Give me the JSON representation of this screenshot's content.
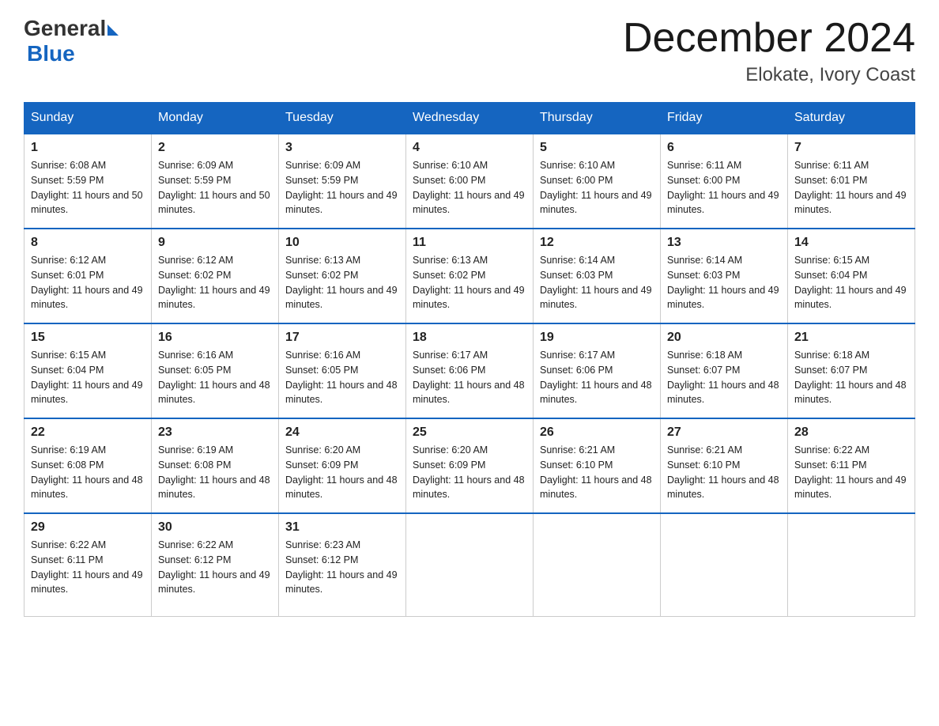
{
  "header": {
    "logo_general": "General",
    "logo_blue": "Blue",
    "month_title": "December 2024",
    "location": "Elokate, Ivory Coast"
  },
  "weekdays": [
    "Sunday",
    "Monday",
    "Tuesday",
    "Wednesday",
    "Thursday",
    "Friday",
    "Saturday"
  ],
  "weeks": [
    [
      {
        "day": "1",
        "sunrise": "6:08 AM",
        "sunset": "5:59 PM",
        "daylight": "11 hours and 50 minutes."
      },
      {
        "day": "2",
        "sunrise": "6:09 AM",
        "sunset": "5:59 PM",
        "daylight": "11 hours and 50 minutes."
      },
      {
        "day": "3",
        "sunrise": "6:09 AM",
        "sunset": "5:59 PM",
        "daylight": "11 hours and 49 minutes."
      },
      {
        "day": "4",
        "sunrise": "6:10 AM",
        "sunset": "6:00 PM",
        "daylight": "11 hours and 49 minutes."
      },
      {
        "day": "5",
        "sunrise": "6:10 AM",
        "sunset": "6:00 PM",
        "daylight": "11 hours and 49 minutes."
      },
      {
        "day": "6",
        "sunrise": "6:11 AM",
        "sunset": "6:00 PM",
        "daylight": "11 hours and 49 minutes."
      },
      {
        "day": "7",
        "sunrise": "6:11 AM",
        "sunset": "6:01 PM",
        "daylight": "11 hours and 49 minutes."
      }
    ],
    [
      {
        "day": "8",
        "sunrise": "6:12 AM",
        "sunset": "6:01 PM",
        "daylight": "11 hours and 49 minutes."
      },
      {
        "day": "9",
        "sunrise": "6:12 AM",
        "sunset": "6:02 PM",
        "daylight": "11 hours and 49 minutes."
      },
      {
        "day": "10",
        "sunrise": "6:13 AM",
        "sunset": "6:02 PM",
        "daylight": "11 hours and 49 minutes."
      },
      {
        "day": "11",
        "sunrise": "6:13 AM",
        "sunset": "6:02 PM",
        "daylight": "11 hours and 49 minutes."
      },
      {
        "day": "12",
        "sunrise": "6:14 AM",
        "sunset": "6:03 PM",
        "daylight": "11 hours and 49 minutes."
      },
      {
        "day": "13",
        "sunrise": "6:14 AM",
        "sunset": "6:03 PM",
        "daylight": "11 hours and 49 minutes."
      },
      {
        "day": "14",
        "sunrise": "6:15 AM",
        "sunset": "6:04 PM",
        "daylight": "11 hours and 49 minutes."
      }
    ],
    [
      {
        "day": "15",
        "sunrise": "6:15 AM",
        "sunset": "6:04 PM",
        "daylight": "11 hours and 49 minutes."
      },
      {
        "day": "16",
        "sunrise": "6:16 AM",
        "sunset": "6:05 PM",
        "daylight": "11 hours and 48 minutes."
      },
      {
        "day": "17",
        "sunrise": "6:16 AM",
        "sunset": "6:05 PM",
        "daylight": "11 hours and 48 minutes."
      },
      {
        "day": "18",
        "sunrise": "6:17 AM",
        "sunset": "6:06 PM",
        "daylight": "11 hours and 48 minutes."
      },
      {
        "day": "19",
        "sunrise": "6:17 AM",
        "sunset": "6:06 PM",
        "daylight": "11 hours and 48 minutes."
      },
      {
        "day": "20",
        "sunrise": "6:18 AM",
        "sunset": "6:07 PM",
        "daylight": "11 hours and 48 minutes."
      },
      {
        "day": "21",
        "sunrise": "6:18 AM",
        "sunset": "6:07 PM",
        "daylight": "11 hours and 48 minutes."
      }
    ],
    [
      {
        "day": "22",
        "sunrise": "6:19 AM",
        "sunset": "6:08 PM",
        "daylight": "11 hours and 48 minutes."
      },
      {
        "day": "23",
        "sunrise": "6:19 AM",
        "sunset": "6:08 PM",
        "daylight": "11 hours and 48 minutes."
      },
      {
        "day": "24",
        "sunrise": "6:20 AM",
        "sunset": "6:09 PM",
        "daylight": "11 hours and 48 minutes."
      },
      {
        "day": "25",
        "sunrise": "6:20 AM",
        "sunset": "6:09 PM",
        "daylight": "11 hours and 48 minutes."
      },
      {
        "day": "26",
        "sunrise": "6:21 AM",
        "sunset": "6:10 PM",
        "daylight": "11 hours and 48 minutes."
      },
      {
        "day": "27",
        "sunrise": "6:21 AM",
        "sunset": "6:10 PM",
        "daylight": "11 hours and 48 minutes."
      },
      {
        "day": "28",
        "sunrise": "6:22 AM",
        "sunset": "6:11 PM",
        "daylight": "11 hours and 49 minutes."
      }
    ],
    [
      {
        "day": "29",
        "sunrise": "6:22 AM",
        "sunset": "6:11 PM",
        "daylight": "11 hours and 49 minutes."
      },
      {
        "day": "30",
        "sunrise": "6:22 AM",
        "sunset": "6:12 PM",
        "daylight": "11 hours and 49 minutes."
      },
      {
        "day": "31",
        "sunrise": "6:23 AM",
        "sunset": "6:12 PM",
        "daylight": "11 hours and 49 minutes."
      },
      null,
      null,
      null,
      null
    ]
  ]
}
